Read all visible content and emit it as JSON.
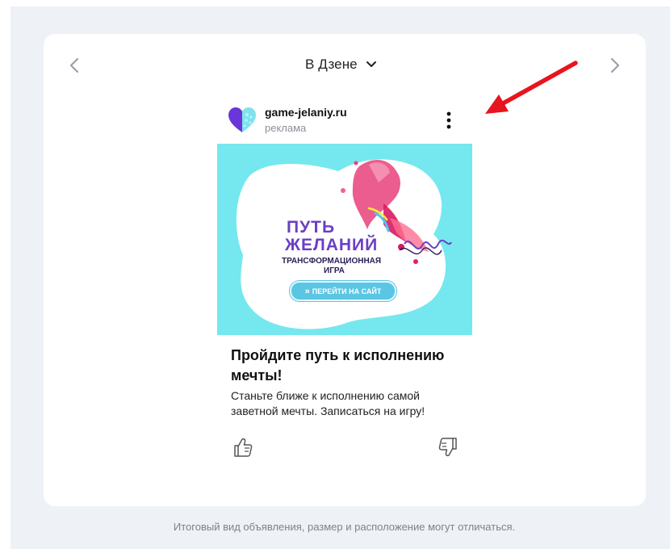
{
  "header": {
    "selector_label": "В Дзене",
    "prev_icon": "chevron-left-icon",
    "next_icon": "chevron-right-icon"
  },
  "ad": {
    "domain": "game-jelaniy.ru",
    "label": "реклама",
    "logo_icon": "heart-logo-icon",
    "menu_icon": "more-vertical-icon",
    "banner": {
      "title_line1": "ПУТЬ",
      "title_line2": "ЖЕЛАНИЙ",
      "subtitle_line1": "ТРАНСФОРМАЦИОННАЯ",
      "subtitle_line2": "ИГРА",
      "cta_icon": "»",
      "cta_label": "ПЕРЕЙТИ НА САЙТ",
      "background_color": "#74e8ee",
      "accent_color": "#6b3fc4"
    },
    "headline": "Пройдите путь к исполнению мечты!",
    "text": "Станьте ближе к исполнению самой заветной мечты. Записаться на игру!",
    "like_icon": "thumbs-up-icon",
    "dislike_icon": "thumbs-down-icon"
  },
  "annotation": {
    "arrow_color": "#e8141e"
  },
  "footer": {
    "note": "Итоговый вид объявления, размер и расположение могут отличаться."
  },
  "colors": {
    "page_background": "#eef1f6",
    "card_background": "#ffffff"
  }
}
